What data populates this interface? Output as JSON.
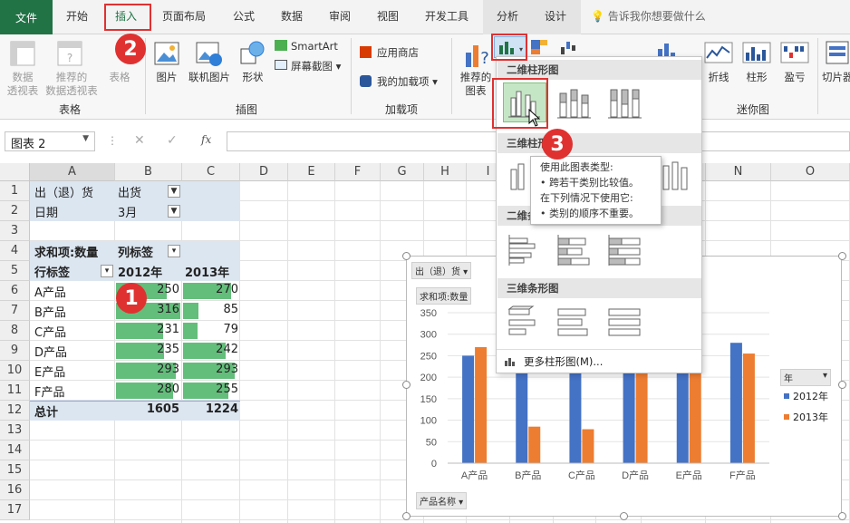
{
  "tabs": [
    "文件",
    "开始",
    "插入",
    "页面布局",
    "公式",
    "数据",
    "审阅",
    "视图",
    "开发工具",
    "分析",
    "设计"
  ],
  "tell_me": "告诉我你想要做什么",
  "ribbon": {
    "pivot": "数据\n透视表",
    "rec_pivot": "推荐的\n数据透视表",
    "table": "表格",
    "picture": "图片",
    "online_picture": "联机图片",
    "shapes": "形状",
    "smartart": "SmartArt",
    "screenshot": "屏幕截图",
    "store": "应用商店",
    "my_addins": "我的加载项",
    "rec_charts": "推荐的\n图表",
    "sparkline_line": "折线",
    "sparkline_col": "柱形",
    "sparkline_wl": "盈亏",
    "slicer": "切片器",
    "groups": {
      "tables": "表格",
      "illustrations": "插图",
      "addins": "加载项",
      "sparklines": "迷你图"
    }
  },
  "formula_bar": {
    "name_box": "图表 2",
    "fx": "fx"
  },
  "columns": [
    "A",
    "B",
    "C",
    "D",
    "E",
    "F",
    "G",
    "H",
    "I",
    "J",
    "K",
    "L",
    "M",
    "N",
    "O"
  ],
  "rows": [
    "1",
    "2",
    "3",
    "4",
    "5",
    "6",
    "7",
    "8",
    "9",
    "10",
    "11",
    "12",
    "13",
    "14",
    "15",
    "16",
    "17"
  ],
  "pivot": {
    "filter1_label": "出（退）货",
    "filter1_value": "出货",
    "filter2_label": "日期",
    "filter2_value": "3月",
    "sum_label": "求和项:数量",
    "col_label": "列标签",
    "row_label": "行标签",
    "year1": "2012年",
    "year2": "2013年",
    "products": [
      "A产品",
      "B产品",
      "C产品",
      "D产品",
      "E产品",
      "F产品"
    ],
    "values_2012": [
      250,
      316,
      231,
      235,
      293,
      280
    ],
    "values_2013": [
      270,
      85,
      79,
      242,
      293,
      255
    ],
    "total_label": "总计",
    "total_2012": "1605",
    "total_2013": "1224"
  },
  "dropdown": {
    "h_2d_col": "二维柱形图",
    "h_3d_col": "三维柱形图",
    "h_2d_bar": "二维条形图",
    "h_3d_bar": "三维条形图",
    "more": "更多柱形图(M)..."
  },
  "tooltip": {
    "title": "使用此图表类型:",
    "l1": "• 跨若干类别比较值。",
    "l2": "在下列情况下使用它:",
    "l3": "• 类别的顺序不重要。"
  },
  "steps": [
    "1",
    "2",
    "3"
  ],
  "chart_data": {
    "type": "bar",
    "categories": [
      "A产品",
      "B产品",
      "C产品",
      "D产品",
      "E产品",
      "F产品"
    ],
    "series": [
      {
        "name": "2012年",
        "values": [
          250,
          316,
          231,
          235,
          293,
          280
        ],
        "color": "#4472c4"
      },
      {
        "name": "2013年",
        "values": [
          270,
          85,
          79,
          242,
          293,
          255
        ],
        "color": "#ed7d31"
      }
    ],
    "ylim": [
      0,
      350
    ],
    "yticks": [
      "0",
      "50",
      "100",
      "150",
      "200",
      "250",
      "300",
      "350"
    ],
    "legend_title": "年",
    "field_filter": "出（退）货",
    "field_value": "求和项:数量",
    "field_axis": "产品名称",
    "legend_position": "right"
  },
  "colors": {
    "excel_green": "#217346",
    "data_bar": "#63be7b",
    "highlight": "#e03131"
  }
}
